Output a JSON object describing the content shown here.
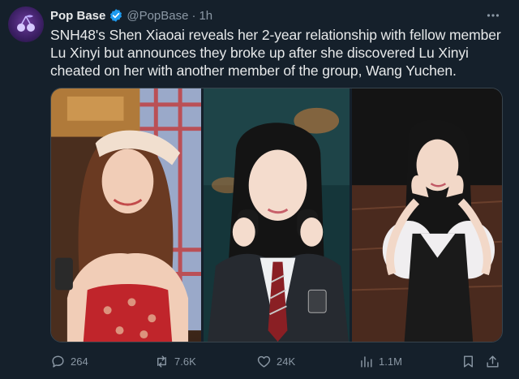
{
  "account": {
    "display_name": "Pop Base",
    "handle": "@PopBase",
    "separator": "·",
    "time": "1h",
    "verified": true,
    "avatar_icon": "cherry-icon"
  },
  "tweet": {
    "text": "SNH48's Shen Xiaoai reveals her 2-year relationship with fellow member Lu Xinyi but announces they broke up after she discovered Lu Xinyi cheated on her with another member of the group, Wang Yuchen."
  },
  "media": {
    "photos": [
      {
        "subject": "woman-in-bandana-red-top"
      },
      {
        "subject": "woman-in-school-uniform-headphones"
      },
      {
        "subject": "woman-posing-heart-hands"
      }
    ]
  },
  "actions": {
    "replies": "264",
    "retweets": "7.6K",
    "likes": "24K",
    "views": "1.1M"
  },
  "colors": {
    "background": "#15202b",
    "text": "#e7e9ea",
    "muted": "#8b98a5",
    "verified": "#1d9bf0",
    "border": "#38444d"
  }
}
